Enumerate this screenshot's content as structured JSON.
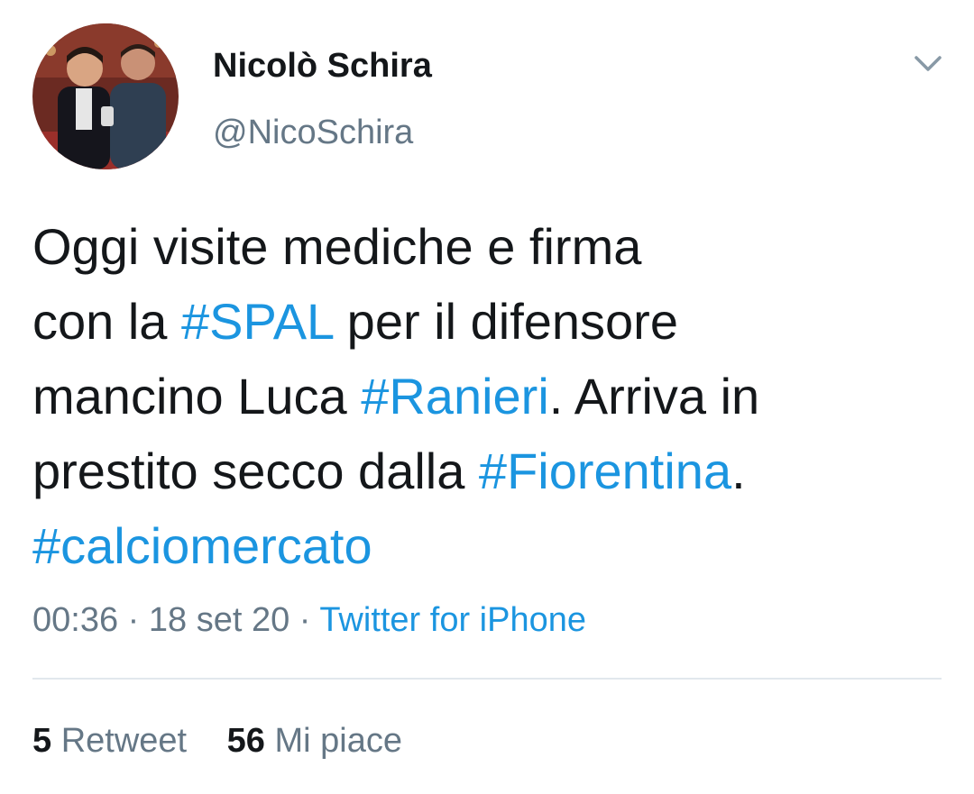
{
  "author": {
    "display_name": "Nicolò Schira",
    "handle": "@NicoSchira"
  },
  "icons": {
    "avatar": "profile-photo",
    "menu": "chevron-down-icon"
  },
  "tweet": {
    "lines": [
      {
        "pre": "Oggi visite mediche e firma"
      },
      {
        "pre": "con la ",
        "tag": "#SPAL",
        "post": " per il difensore"
      },
      {
        "pre": "mancino Luca ",
        "tag": "#Ranieri",
        "post": ". Arriva in"
      },
      {
        "pre": "prestito secco dalla ",
        "tag": "#Fiorentina",
        "post": "."
      },
      {
        "tag": "#calciomercato"
      }
    ]
  },
  "meta": {
    "time": "00:36",
    "separator": " · ",
    "date": "18 set 20",
    "source": "Twitter for iPhone"
  },
  "stats": {
    "retweets_count": "5",
    "retweets_label": "Retweet",
    "likes_count": "56",
    "likes_label": "Mi piace"
  },
  "colors": {
    "text": "#14171a",
    "secondary": "#657786",
    "link": "#1b95e0",
    "divider": "#e1e8ed"
  }
}
